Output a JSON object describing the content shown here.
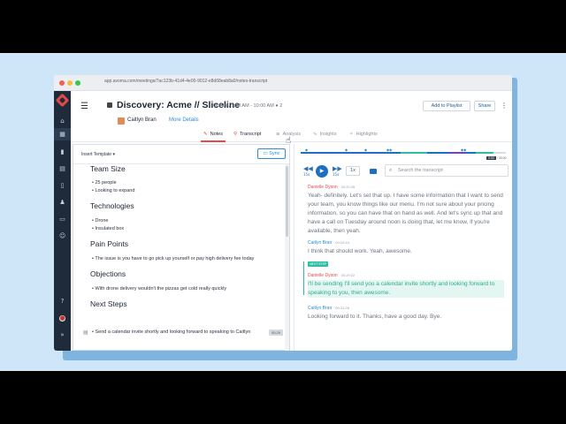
{
  "browser": {
    "url": "app.avoma.com/meetings/7ac123b-41d4-4e00-9012-e8d68eab8a0/notes-transcript"
  },
  "colors": {
    "accent": "#2e8bd6",
    "brand": "#e24a4a",
    "highlight": "#2bbfa4",
    "sidebar": "#1f2b3b"
  },
  "sidebar": {
    "icons": [
      "logo-icon",
      "home-icon",
      "calendar-icon",
      "chart-icon",
      "book-icon",
      "document-icon",
      "users-icon",
      "briefcase-icon",
      "user-icon",
      "help-icon",
      "avatar",
      "expand-icon"
    ]
  },
  "header": {
    "title": "Discovery: Acme // Sliceline",
    "meta": "Oct 1st, 9:30 AM - 10:00 AM",
    "attendee_count": "2",
    "person": "Caitlyn Bran",
    "more_details": "More Details",
    "add_to_playlist": "Add to Playlist",
    "share": "Share"
  },
  "tabs": [
    {
      "label": "Notes",
      "icon": "notes-icon"
    },
    {
      "label": "Transcript",
      "icon": "transcript-icon"
    },
    {
      "label": "Analysis",
      "icon": "analysis-icon"
    },
    {
      "label": "Insights",
      "icon": "insights-icon"
    },
    {
      "label": "Highlights",
      "icon": "highlights-icon"
    }
  ],
  "notes": {
    "template_label": "Insert Template",
    "sync_label": "Sync",
    "sections": [
      {
        "heading": "Team Size",
        "items": [
          "25 people",
          "Looking to expand"
        ]
      },
      {
        "heading": "Technologies",
        "items": [
          "Drone",
          "Insulated box"
        ]
      },
      {
        "heading": "Pain Points",
        "items": [
          "The issue is you have to go pick up yourself or pay high delivery fee today"
        ]
      },
      {
        "heading": "Objections",
        "items": [
          "With drone delivery wouldn't the pizzas get cold really quickly"
        ]
      },
      {
        "heading": "Next Steps",
        "items": [
          "Send a calendar invite shortly and looking forward to speaking to Caitlyn"
        ]
      }
    ],
    "next_step_time": "00:29"
  },
  "player": {
    "rewind_label": "15s",
    "forward_label": "15s",
    "speed": "1x",
    "time_current": "0:00",
    "time_total": "30:00",
    "search_placeholder": "Search the transcript"
  },
  "transcript": [
    {
      "speaker": "Danielle Dyson",
      "time": "00:20:45",
      "speaker_color": "#e24a4a",
      "text": "Yeah- definitely. Let's set that up. I have some information that I want to send your team, you know things like our menu. I'm not sure about your pricing information, so you can have that on hand as well. And let's sync up that and have a call on Tuesday around noon is doing that, let me know, if you're available, then yeah."
    },
    {
      "speaker": "Caitlyn Bran",
      "time": "00:24:43",
      "speaker_color": "#2e8bd6",
      "text": "I think that should work. Yeah, awesome."
    },
    {
      "speaker": "Danielle Dyson",
      "time": "00:29:22",
      "speaker_color": "#e24a4a",
      "tag": "NEXT STEP",
      "text": "I'll be sending I'll send you a calendar invite shortly and looking forward to speaking to you, then awesome."
    },
    {
      "speaker": "Caitlyn Bran",
      "time": "00:31:28",
      "speaker_color": "#2e8bd6",
      "text": "Looking forward to it. Thanks, have a good day. Bye."
    }
  ]
}
